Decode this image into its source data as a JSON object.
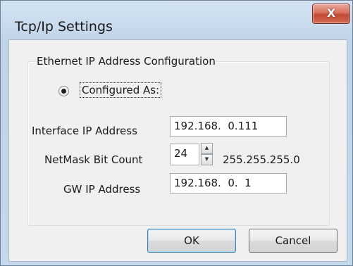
{
  "window": {
    "title": "Tcp/Ip Settings",
    "close_symbol": "X"
  },
  "group": {
    "legend": "Ethernet IP Address Configuration"
  },
  "radio": {
    "label": "Configured As:",
    "selected": true
  },
  "fields": {
    "interface_ip": {
      "label": "Interface IP Address",
      "value": "192.168.  0.111"
    },
    "netmask_bits": {
      "label": "NetMask Bit Count",
      "value": "24",
      "mask_text": "255.255.255.0"
    },
    "gw_ip": {
      "label": "GW IP Address",
      "value": "192.168.  0.  1"
    }
  },
  "buttons": {
    "ok": "OK",
    "cancel": "Cancel"
  }
}
